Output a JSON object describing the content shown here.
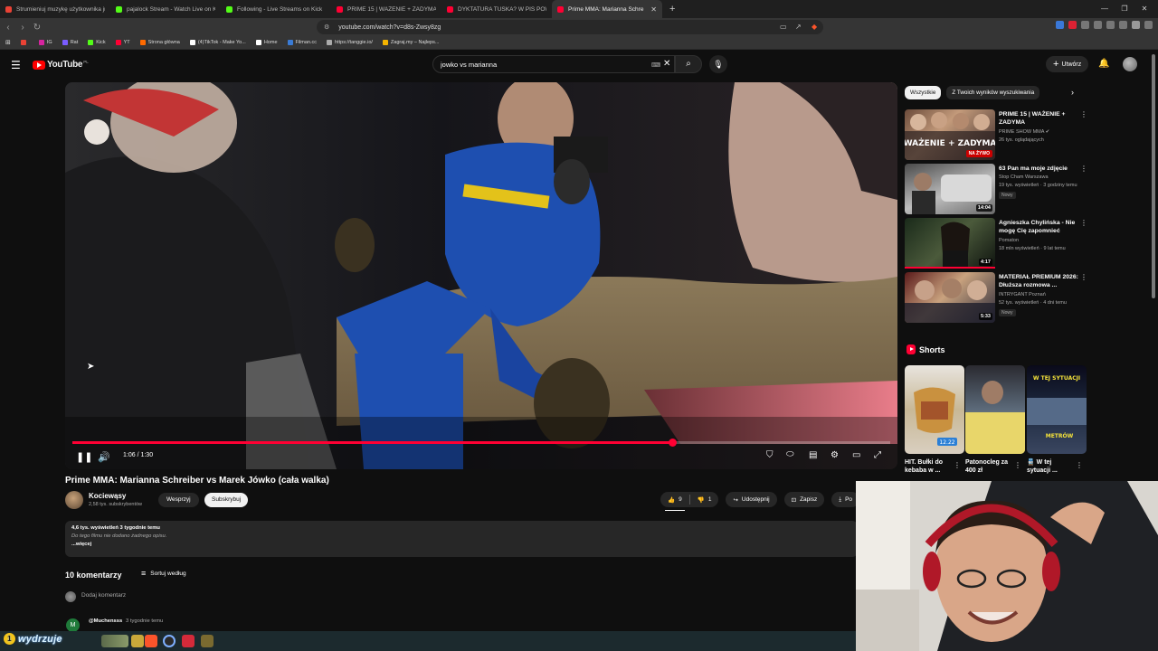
{
  "browser": {
    "tabs": [
      {
        "label": "Strumieniuj muzykę użytkownika jn",
        "color": "#e94235",
        "active": false
      },
      {
        "label": "pajalock Stream - Watch Live on Kick",
        "color": "#53fc18",
        "active": false
      },
      {
        "label": "Following - Live Streams on Kick",
        "color": "#53fc18",
        "active": false
      },
      {
        "label": "PRIME 15 | WAŻENIE + ZADYMA",
        "color": "#ff0033",
        "active": false
      },
      {
        "label": "DYKTATURA TUSKA? W PIS POWARI",
        "color": "#ff0033",
        "active": false
      },
      {
        "label": "Prime MMA: Marianna Schre",
        "color": "#ff0033",
        "active": true
      }
    ],
    "close_glyph": "✕",
    "new_tab_glyph": "+",
    "url": "youtube.com/watch?v=d8s-Zwsy8zg",
    "window_controls": [
      "—",
      "❐",
      "✕"
    ],
    "bookmarks": [
      {
        "label": "",
        "color": "#e94235"
      },
      {
        "label": "IG",
        "color": "#d6249f"
      },
      {
        "label": "Rat",
        "color": "#7a5cff"
      },
      {
        "label": "Kick",
        "color": "#53fc18"
      },
      {
        "label": "YT",
        "color": "#ff0033"
      },
      {
        "label": "Strona główna",
        "color": "#ff6a00"
      },
      {
        "label": "(4)TikTok - Make Yo...",
        "color": "#ffffff"
      },
      {
        "label": "Home",
        "color": "#ffffff"
      },
      {
        "label": "Filman.cc",
        "color": "#3a7bd5"
      },
      {
        "label": "https://tanggie.io/",
        "color": "#aaaaaa"
      },
      {
        "label": "Zagraj.my – Najleps...",
        "color": "#f4b400"
      }
    ]
  },
  "youtube": {
    "logo_text": "YouTube",
    "country": "PL",
    "search_value": "jowko vs marianna",
    "create_label": "Utwórz",
    "colors": {
      "accent": "#ff0033",
      "bg": "#0f0f0f",
      "surface": "#272727"
    }
  },
  "player": {
    "current_time": "1:06",
    "duration": "1:30",
    "time_display": "1:06 / 1:30",
    "progress_fraction": 0.733
  },
  "video": {
    "title": "Prime MMA: Marianna Schreiber vs Marek Jówko (cała walka)",
    "channel": "Kociewąsy",
    "subscribers": "2,58 tys. subskrybentów",
    "support_label": "Wesprzyj",
    "subscribe_label": "Subskrybuj",
    "likes": "9",
    "dislikes": "1",
    "share_label": "Udostępnij",
    "save_label": "Zapisz",
    "download_label": "Po",
    "stats": "4,6 tys. wyświetleń  3 tygodnie temu",
    "description": "Do tego filmu nie dodano żadnego opisu.",
    "more": "...więcej"
  },
  "comments": {
    "count_label": "10 komentarzy",
    "sort_label": "Sortuj według",
    "add_placeholder": "Dodaj komentarz",
    "first": {
      "avatar_letter": "M",
      "author": "@Muchensss",
      "time": "3 tygodnie temu"
    }
  },
  "sidebar": {
    "chips": [
      "Wszystkie",
      "Z Twoich wyników wyszukiwania"
    ],
    "recommendations": [
      {
        "title": "PRIME 15 | WAŻENIE + ZADYMA",
        "channel": "PRIME SHOW MMA",
        "meta": "26 tys. oglądających",
        "badge": "",
        "duration": "",
        "live": "NA ŻYWO"
      },
      {
        "title": "63 Pan ma moje zdjęcie",
        "channel": "Stop Cham Warszawa",
        "meta": "19 tys. wyświetleń · 3 godziny temu",
        "badge": "Nowy",
        "duration": "14:04",
        "live": ""
      },
      {
        "title": "Agnieszka Chylińska - Nie mogę Cię zapomnieć",
        "channel": "Pomaton",
        "meta": "18 mln wyświetleń · 9 lat temu",
        "badge": "",
        "duration": "4:17",
        "live": ""
      },
      {
        "title": "MATERIAŁ PREMIUM 2026: Dłuższa rozmowa ...",
        "channel": "INTRYGANT Poznań",
        "meta": "52 tys. wyświetleń · 4 dni temu",
        "badge": "Nowy",
        "duration": "5:33",
        "live": ""
      }
    ],
    "thumb_texts": [
      "WAŻENIE + ZADYMA"
    ],
    "shorts_heading": "Shorts",
    "shorts": [
      {
        "title": "HIT. Bułki do kebaba w ...",
        "overlay": "12.22"
      },
      {
        "title": "Patonocleg za 400 zł",
        "overlay": ""
      },
      {
        "title": "🚆 W tej sytuacji ...",
        "overlay": "W TEJ SYTUACJI"
      }
    ],
    "shorts_thumb_texts": [
      "W TEJ SYTUACJI",
      "METRÓW"
    ]
  },
  "taskbar": {
    "streamer_tag": "wydrzuje",
    "badge_count": "1"
  },
  "icons": [
    "hamburger-icon",
    "search-icon",
    "mic-icon",
    "bell-icon",
    "pause-icon",
    "volume-icon",
    "settings-icon",
    "fullscreen-icon",
    "like-icon",
    "dislike-icon",
    "share-icon",
    "save-icon",
    "download-icon",
    "sort-icon",
    "more-vert-icon"
  ]
}
